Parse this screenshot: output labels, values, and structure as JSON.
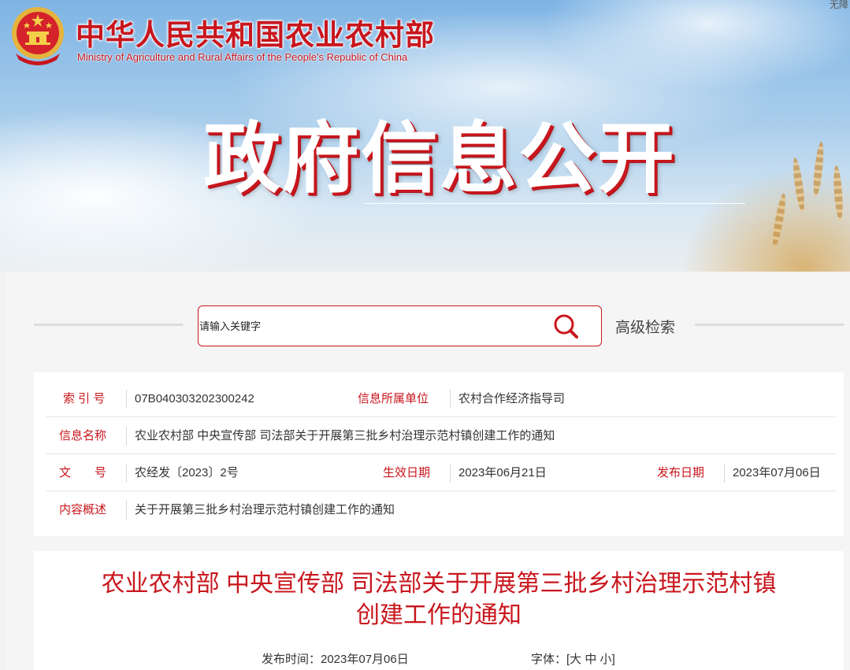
{
  "header": {
    "title_cn": "中华人民共和国农业农村部",
    "title_en": "Ministry of Agriculture and Rural Affairs of the People's Republic of China",
    "banner_title": "政府信息公开",
    "corner_text": "无障"
  },
  "search": {
    "placeholder": "请输入关键字",
    "advanced_label": "高级检索"
  },
  "meta": {
    "index_label": "索 引 号",
    "index_value": "07B040303202300242",
    "unit_label": "信息所属单位",
    "unit_value": "农村合作经济指导司",
    "name_label": "信息名称",
    "name_value": "农业农村部 中央宣传部 司法部关于开展第三批乡村治理示范村镇创建工作的通知",
    "doc_label": "文　　号",
    "doc_value": "农经发〔2023〕2号",
    "effective_label": "生效日期",
    "effective_value": "2023年06月21日",
    "publish_label": "发布日期",
    "publish_value": "2023年07月06日",
    "summary_label": "内容概述",
    "summary_value": "关于开展第三批乡村治理示范村镇创建工作的通知"
  },
  "article": {
    "title_line1": "农业农村部 中央宣传部 司法部关于开展第三批乡村治理示范村镇",
    "title_line2": "创建工作的通知",
    "publish_time": "发布时间：2023年07月06日",
    "font_size_prefix": "字体：[",
    "font_size_large": "大",
    "font_size_medium": "中",
    "font_size_small": "小",
    "font_size_suffix": "]"
  },
  "colors": {
    "brand_red": "#c8161d",
    "sky_blue": "#7eb4e4"
  }
}
